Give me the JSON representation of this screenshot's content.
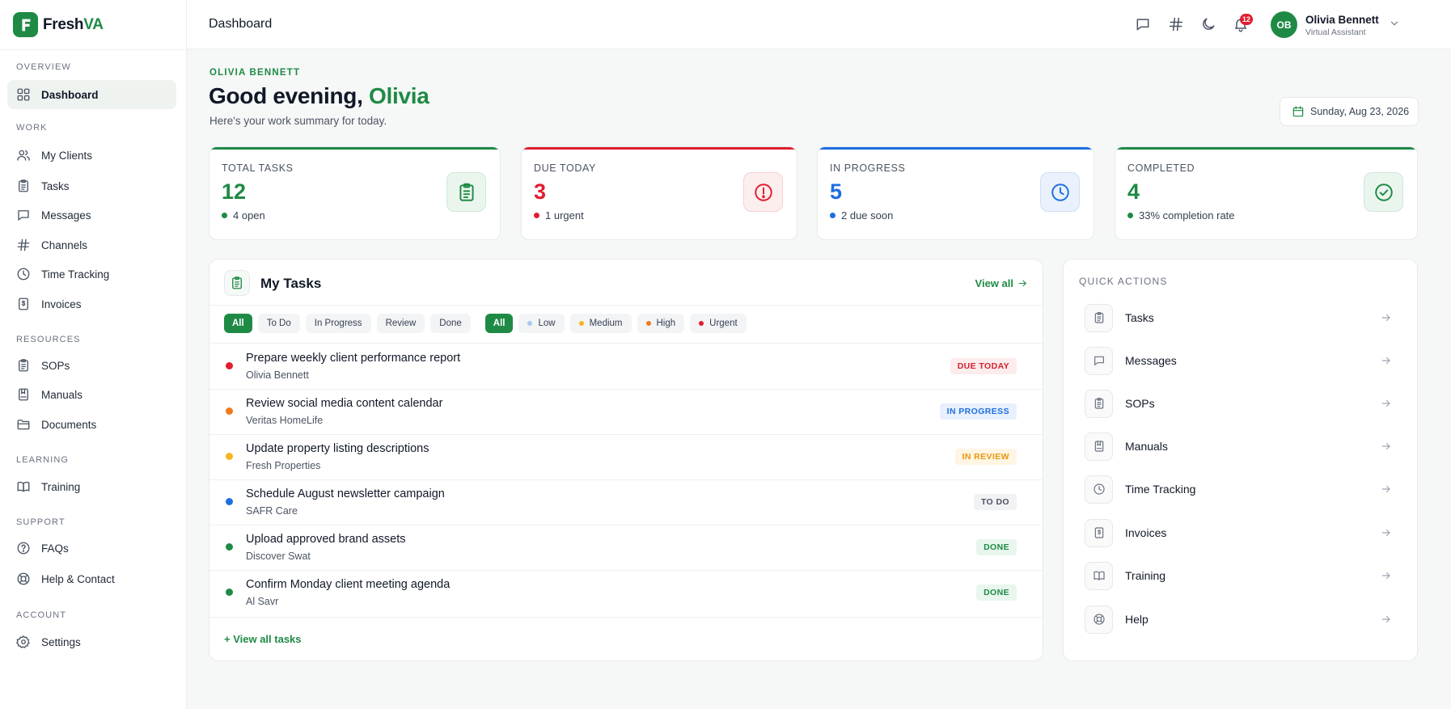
{
  "brand": {
    "part1": "Fresh",
    "part2": "VA",
    "logo_letter": "F"
  },
  "sidebar": {
    "sections": [
      {
        "label": "OVERVIEW"
      },
      {
        "label": "WORK"
      },
      {
        "label": "RESOURCES"
      },
      {
        "label": "LEARNING"
      },
      {
        "label": "SUPPORT"
      },
      {
        "label": "ACCOUNT"
      }
    ],
    "items": [
      {
        "label": "Dashboard",
        "icon": "grid-icon",
        "active": true
      },
      {
        "label": "My Clients",
        "icon": "users-icon"
      },
      {
        "label": "Tasks",
        "icon": "clipboard-icon"
      },
      {
        "label": "Messages",
        "icon": "message-icon"
      },
      {
        "label": "Channels",
        "icon": "hash-icon"
      },
      {
        "label": "Time Tracking",
        "icon": "clock-icon"
      },
      {
        "label": "Invoices",
        "icon": "invoice-icon"
      },
      {
        "label": "SOPs",
        "icon": "clipboard-icon"
      },
      {
        "label": "Manuals",
        "icon": "manual-icon"
      },
      {
        "label": "Documents",
        "icon": "folder-icon"
      },
      {
        "label": "Training",
        "icon": "book-icon"
      },
      {
        "label": "FAQs",
        "icon": "help-circle-icon"
      },
      {
        "label": "Help & Contact",
        "icon": "lifebuoy-icon"
      },
      {
        "label": "Settings",
        "icon": "gear-icon"
      }
    ]
  },
  "topbar": {
    "title": "Dashboard",
    "notifications_count": "12",
    "user": {
      "initials": "OB",
      "name": "Olivia Bennett",
      "role": "Virtual Assistant"
    }
  },
  "header": {
    "eyebrow": "OLIVIA BENNETT",
    "greeting_prefix": "Good evening, ",
    "greeting_name": "Olivia",
    "subtitle": "Here's your work summary for today.",
    "date": "Sunday, Aug 23, 2026"
  },
  "stats": [
    {
      "label": "TOTAL TASKS",
      "value": "12",
      "note": "4 open",
      "color": "#1e8a45"
    },
    {
      "label": "DUE TODAY",
      "value": "3",
      "note": "1 urgent",
      "color": "#e11d2e"
    },
    {
      "label": "IN PROGRESS",
      "value": "5",
      "note": "2 due soon",
      "color": "#1d6fe0"
    },
    {
      "label": "COMPLETED",
      "value": "4",
      "note": "33% completion rate",
      "color": "#1e8a45"
    }
  ],
  "tasks": {
    "title": "My Tasks",
    "view_all": "View all",
    "status_filters": [
      "All",
      "To Do",
      "In Progress",
      "Review",
      "Done"
    ],
    "priority_filters": [
      "All",
      "Low",
      "Medium",
      "High",
      "Urgent"
    ],
    "rows": [
      {
        "title": "Prepare weekly client performance report",
        "client": "Olivia Bennett",
        "status": "DUE TODAY",
        "priority_color": "#e11d2e"
      },
      {
        "title": "Review social media content calendar",
        "client": "Veritas HomeLife",
        "status": "IN PROGRESS",
        "priority_color": "#f07c1a"
      },
      {
        "title": "Update property listing descriptions",
        "client": "Fresh Properties",
        "status": "IN REVIEW",
        "priority_color": "#f5b51c"
      },
      {
        "title": "Schedule August newsletter campaign",
        "client": "SAFR Care",
        "status": "TO DO",
        "priority_color": "#1d6fe0"
      },
      {
        "title": "Upload approved brand assets",
        "client": "Discover Swat",
        "status": "DONE",
        "priority_color": "#1e8a45"
      },
      {
        "title": "Confirm Monday client meeting agenda",
        "client": "Al Savr",
        "status": "DONE",
        "priority_color": "#1e8a45"
      }
    ],
    "view_all_tasks": "+  View all tasks"
  },
  "quick_actions": {
    "title": "QUICK ACTIONS",
    "items": [
      {
        "label": "Tasks",
        "icon": "clipboard-icon"
      },
      {
        "label": "Messages",
        "icon": "message-icon"
      },
      {
        "label": "SOPs",
        "icon": "clipboard-icon"
      },
      {
        "label": "Manuals",
        "icon": "manual-icon"
      },
      {
        "label": "Time Tracking",
        "icon": "clock-icon"
      },
      {
        "label": "Invoices",
        "icon": "invoice-icon"
      },
      {
        "label": "Training",
        "icon": "book-icon"
      },
      {
        "label": "Help",
        "icon": "lifebuoy-icon"
      }
    ]
  }
}
